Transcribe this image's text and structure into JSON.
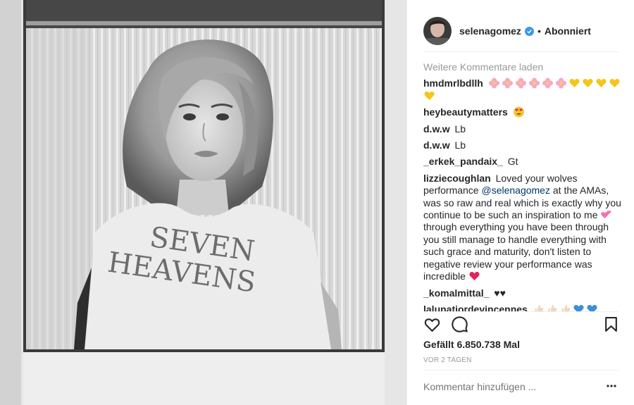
{
  "post": {
    "username": "selenagomez",
    "follow_status": "Abonniert",
    "separator": "•"
  },
  "photo": {
    "shirt_text_line1": "SEVEN",
    "shirt_text_line2": "HEAVENS"
  },
  "comments": {
    "load_more": "Weitere Kommentare laden",
    "items": [
      {
        "user": "hmdmrlbdllh",
        "text": "",
        "emoji": [
          "pink-flower",
          "pink-flower",
          "pink-flower",
          "pink-flower",
          "pink-flower",
          "pink-flower",
          "yellow-heart",
          "yellow-heart",
          "yellow-heart",
          "yellow-heart",
          "yellow-heart"
        ]
      },
      {
        "user": "heybeautymatters",
        "text": "",
        "emoji": [
          "heart-eyes-face"
        ]
      },
      {
        "user": "d.w.w",
        "text": "Lb"
      },
      {
        "user": "d.w.w",
        "text": "Lb"
      },
      {
        "user": "_erkek_pandaix_",
        "text": "Gt"
      },
      {
        "user": "lizziecoughlan",
        "text_before": "Loved your wolves performance",
        "mention": "@selenagomez",
        "text_after": "at the AMAs, was so raw and real which is exactly why you continue to be such an inspiration to me",
        "text_after2": "through everything you have been through you still manage to handle everything with such grace and maturity, don't listen to negative review your performance was incredible",
        "emoji": [
          "two-hearts",
          "red-heart"
        ]
      },
      {
        "user": "_komalmittal_",
        "text": "♥♥"
      },
      {
        "user": "lalunatiordevincennes",
        "emoji": [
          "thumbs-up",
          "thumbs-up",
          "thumbs-up",
          "blue-heart",
          "blue-heart"
        ]
      }
    ]
  },
  "actions": {
    "likes": "Gefällt 6.850.738 Mal",
    "date": "VOR 2 TAGEN",
    "comment_placeholder": "Kommentar hinzufügen ..."
  },
  "icons": {
    "like": "heart-outline-icon",
    "comment": "comment-bubble-icon",
    "save": "bookmark-icon",
    "more": "more-options-icon",
    "verified": "verified-badge-icon"
  },
  "colors": {
    "verified": "#3897f0",
    "mention": "#003569",
    "muted": "#999999",
    "text": "#262626"
  }
}
